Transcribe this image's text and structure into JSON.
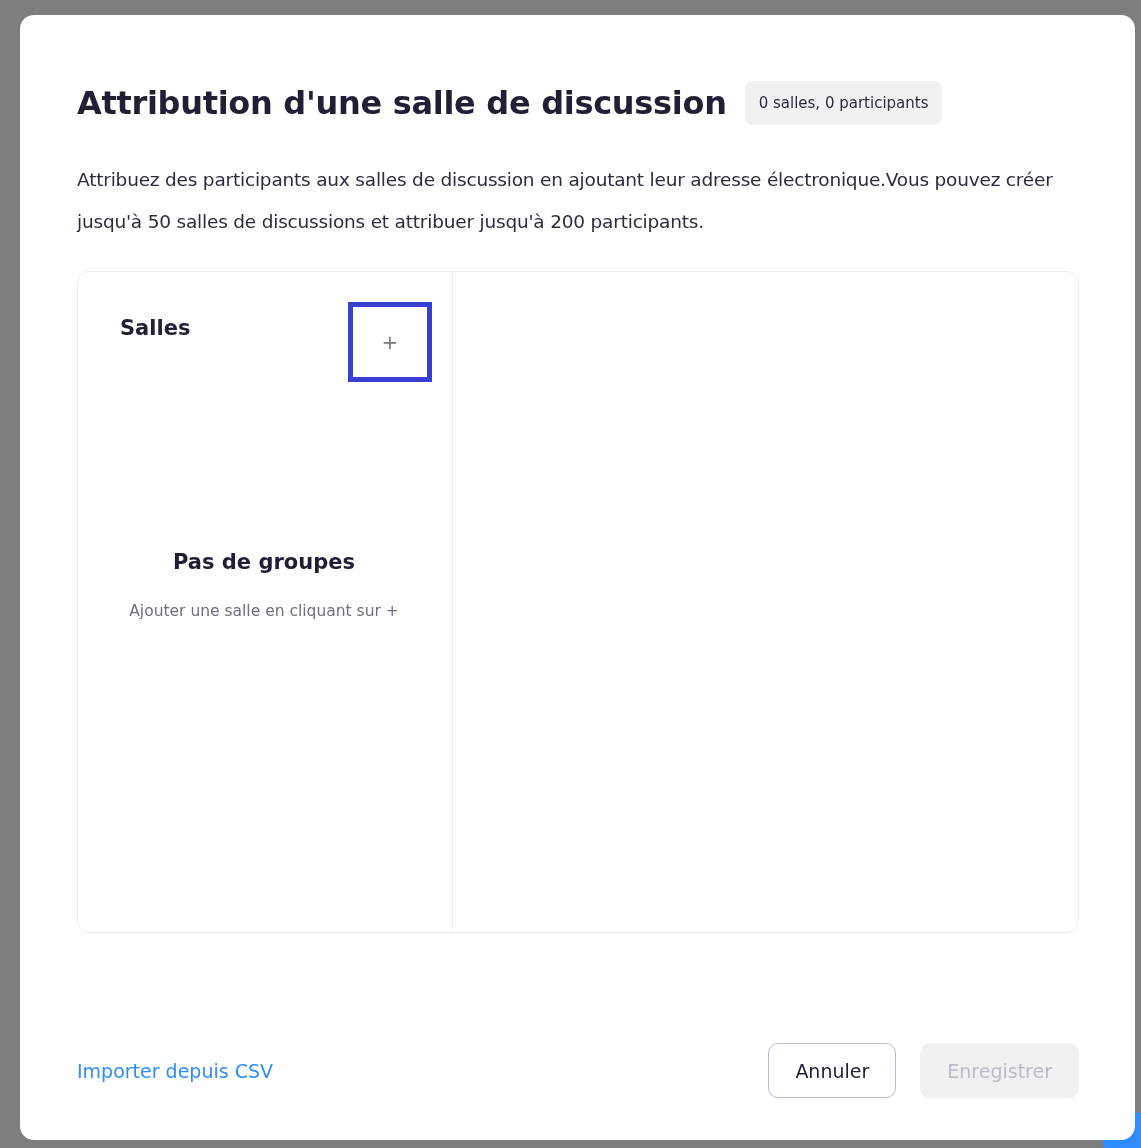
{
  "dialog": {
    "title": "Attribution d'une salle de discussion",
    "summary_badge": "0 salles, 0 participants",
    "description": "Attribuez des participants aux salles de discussion en ajoutant leur adresse électronique.Vous pouvez créer jusqu'à 50 salles de discussions et attribuer jusqu'à 200 participants."
  },
  "rooms_panel": {
    "heading": "Salles",
    "add_button": {
      "label": "+",
      "focused": true
    },
    "empty_state": {
      "title": "Pas de groupes",
      "hint": "Ajouter une salle en cliquant sur +"
    }
  },
  "footer": {
    "import_link": "Importer depuis CSV",
    "buttons": [
      {
        "label": "Annuler",
        "kind": "secondary",
        "disabled": false
      },
      {
        "label": "Enregistrer",
        "kind": "primary",
        "disabled": true
      }
    ]
  }
}
